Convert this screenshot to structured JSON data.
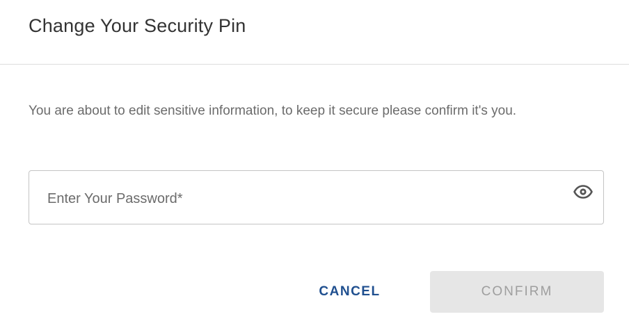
{
  "dialog": {
    "title": "Change Your Security Pin",
    "description": "You are about to edit sensitive information, to keep it secure please confirm it's you.",
    "password_field": {
      "placeholder": "Enter Your Password*",
      "value": "",
      "toggle_icon": "eye-icon"
    },
    "actions": {
      "cancel_label": "CANCEL",
      "confirm_label": "CONFIRM",
      "confirm_disabled": true
    }
  },
  "colors": {
    "title": "#333333",
    "body_text": "#6b6b6b",
    "cancel_text": "#1f4f8f",
    "confirm_bg_disabled": "#e6e6e6",
    "confirm_text_disabled": "#9e9e9e",
    "divider": "#dddddd",
    "field_border": "#c4c4c4"
  }
}
